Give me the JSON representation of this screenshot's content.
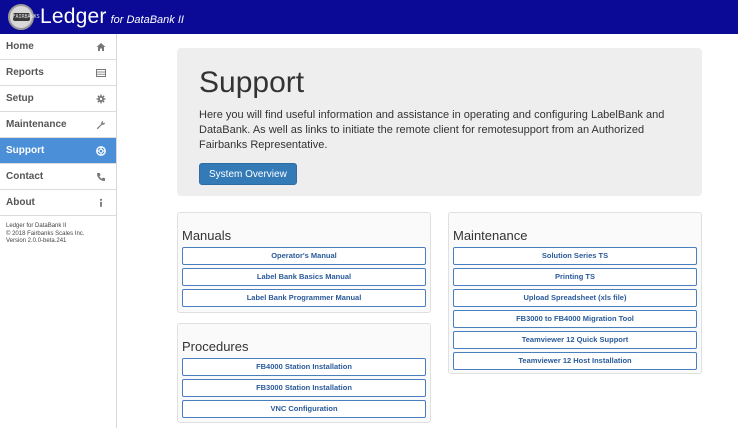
{
  "header": {
    "brand": "Ledger",
    "brand_sub": "for DataBank II",
    "logo_text": "FAIRBANKS"
  },
  "sidebar": {
    "items": [
      {
        "label": "Home",
        "icon": "home-icon",
        "active": false
      },
      {
        "label": "Reports",
        "icon": "list-icon",
        "active": false
      },
      {
        "label": "Setup",
        "icon": "gear-icon",
        "active": false
      },
      {
        "label": "Maintenance",
        "icon": "wrench-icon",
        "active": false
      },
      {
        "label": "Support",
        "icon": "lifebuoy-icon",
        "active": true
      },
      {
        "label": "Contact",
        "icon": "phone-icon",
        "active": false
      },
      {
        "label": "About",
        "icon": "info-icon",
        "active": false
      }
    ],
    "footer": {
      "line1": "Ledger for DataBank II",
      "line2": "© 2018 Fairbanks Scales Inc.",
      "line3": "Version 2.0.0-beta.241"
    }
  },
  "hero": {
    "title": "Support",
    "text": "Here you will find useful information and assistance in operating and configuring LabelBank and DataBank. As well as links to initiate the remote client for remotesupport from an Authorized Fairbanks Representative.",
    "button": "System Overview"
  },
  "manuals": {
    "title": "Manuals",
    "links": [
      "Operator's Manual",
      "Label Bank Basics Manual",
      "Label Bank Programmer Manual"
    ]
  },
  "procedures": {
    "title": "Procedures",
    "links": [
      "FB4000 Station Installation",
      "FB3000 Station Installation",
      "VNC Configuration"
    ]
  },
  "maintenance": {
    "title": "Maintenance",
    "links": [
      "Solution Series TS",
      "Printing TS",
      "Upload Spreadsheet (xls file)",
      "FB3000 to FB4000 Migration Tool",
      "Teamviewer 12 Quick Support",
      "Teamviewer 12 Host Installation"
    ]
  },
  "colors": {
    "topbar": "#0a0a96",
    "active_nav": "#4a8fd8",
    "primary_button": "#337ab7"
  }
}
